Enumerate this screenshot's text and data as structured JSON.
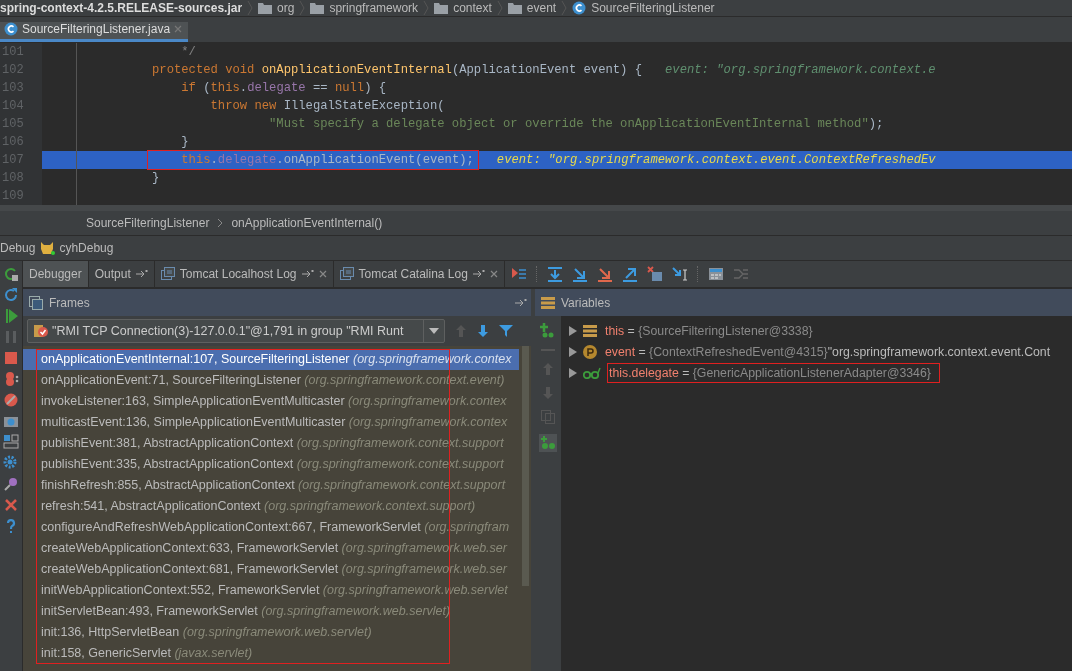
{
  "breadcrumbs": [
    {
      "label": "spring-context-4.2.5.RELEASE-sources.jar",
      "kind": "jar"
    },
    {
      "label": "org",
      "kind": "folder"
    },
    {
      "label": "springframework",
      "kind": "folder"
    },
    {
      "label": "context",
      "kind": "folder"
    },
    {
      "label": "event",
      "kind": "folder"
    },
    {
      "label": "SourceFilteringListener",
      "kind": "class"
    }
  ],
  "editor_tabs": [
    {
      "label": "SourceFilteringListener.java",
      "selected": true
    }
  ],
  "code_lines": [
    {
      "number": "101",
      "highlighted": false,
      "outlined": false,
      "tokens": [
        {
          "kind": "comment",
          "text": "    */"
        }
      ]
    },
    {
      "number": "102",
      "highlighted": false,
      "outlined": false,
      "tokens": [
        {
          "kind": "kw",
          "text": "protected void "
        },
        {
          "kind": "fn",
          "text": "onApplicationEventInternal"
        },
        {
          "kind": "plain",
          "text": "(ApplicationEvent event) {"
        }
      ],
      "hint": "event: \"org.springframework.context.e"
    },
    {
      "number": "103",
      "highlighted": false,
      "outlined": false,
      "tokens": [
        {
          "kind": "kw",
          "text": "    if "
        },
        {
          "kind": "plain",
          "text": "("
        },
        {
          "kind": "kw",
          "text": "this"
        },
        {
          "kind": "plain",
          "text": "."
        },
        {
          "kind": "field",
          "text": "delegate"
        },
        {
          "kind": "plain",
          "text": " == "
        },
        {
          "kind": "kw",
          "text": "null"
        },
        {
          "kind": "plain",
          "text": ") {"
        }
      ]
    },
    {
      "number": "104",
      "highlighted": false,
      "outlined": false,
      "tokens": [
        {
          "kind": "kw",
          "text": "        throw new "
        },
        {
          "kind": "plain",
          "text": "IllegalStateException("
        }
      ]
    },
    {
      "number": "105",
      "highlighted": false,
      "outlined": false,
      "tokens": [
        {
          "kind": "str",
          "text": "                \"Must specify a delegate object or override the onApplicationEventInternal method\""
        },
        {
          "kind": "plain",
          "text": ");"
        }
      ]
    },
    {
      "number": "106",
      "highlighted": false,
      "outlined": false,
      "tokens": [
        {
          "kind": "plain",
          "text": "    }"
        }
      ]
    },
    {
      "number": "107",
      "highlighted": true,
      "outlined": true,
      "tokens": [
        {
          "kind": "kw",
          "text": "    this"
        },
        {
          "kind": "plain",
          "text": "."
        },
        {
          "kind": "field",
          "text": "delegate"
        },
        {
          "kind": "plain",
          "text": ".onApplicationEvent(event);"
        }
      ],
      "hint": "event: \"org.springframework.context.event.ContextRefreshedEv"
    },
    {
      "number": "108",
      "highlighted": false,
      "outlined": false,
      "tokens": [
        {
          "kind": "plain",
          "text": "}"
        }
      ]
    },
    {
      "number": "109",
      "highlighted": false,
      "outlined": false
    }
  ],
  "code_breadcrumbs": [
    "SourceFilteringListener",
    "onApplicationEventInternal()"
  ],
  "debug_title": {
    "label": "Debug",
    "config": "cyhDebug"
  },
  "tool_tabs": [
    {
      "label": "Debugger",
      "selected": true,
      "kind": "plain"
    },
    {
      "label": "Output",
      "selected": false,
      "kind": "pinned"
    },
    {
      "label": "Tomcat Localhost Log",
      "selected": false,
      "kind": "log"
    },
    {
      "label": "Tomcat Catalina Log",
      "selected": false,
      "kind": "log"
    }
  ],
  "frames": {
    "title": "Frames",
    "thread": "\"RMI TCP Connection(3)-127.0.0.1\"@1,791 in group \"RMI Runt",
    "items": [
      {
        "method": "onApplicationEventInternal:107, SourceFilteringListener",
        "package": "(org.springframework.contex",
        "selected": true,
        "outlined": true
      },
      {
        "method": "onApplicationEvent:71, SourceFilteringListener",
        "package": "(org.springframework.context.event)",
        "selected": false,
        "outlined": true
      },
      {
        "method": "invokeListener:163, SimpleApplicationEventMulticaster",
        "package": "(org.springframework.contex",
        "selected": false,
        "outlined": true
      },
      {
        "method": "multicastEvent:136, SimpleApplicationEventMulticaster",
        "package": "(org.springframework.contex",
        "selected": false,
        "outlined": true
      },
      {
        "method": "publishEvent:381, AbstractApplicationContext",
        "package": "(org.springframework.context.support",
        "selected": false,
        "outlined": true
      },
      {
        "method": "publishEvent:335, AbstractApplicationContext",
        "package": "(org.springframework.context.support",
        "selected": false,
        "outlined": true
      },
      {
        "method": "finishRefresh:855, AbstractApplicationContext",
        "package": "(org.springframework.context.support",
        "selected": false,
        "outlined": true
      },
      {
        "method": "refresh:541, AbstractApplicationContext",
        "package": "(org.springframework.context.support)",
        "selected": false,
        "outlined": true
      },
      {
        "method": "configureAndRefreshWebApplicationContext:667, FrameworkServlet",
        "package": "(org.springfram",
        "selected": false,
        "outlined": true
      },
      {
        "method": "createWebApplicationContext:633, FrameworkServlet",
        "package": "(org.springframework.web.ser",
        "selected": false,
        "outlined": true
      },
      {
        "method": "createWebApplicationContext:681, FrameworkServlet",
        "package": "(org.springframework.web.ser",
        "selected": false,
        "outlined": true
      },
      {
        "method": "initWebApplicationContext:552, FrameworkServlet",
        "package": "(org.springframework.web.servlet",
        "selected": false,
        "outlined": true
      },
      {
        "method": "initServletBean:493, FrameworkServlet",
        "package": "(org.springframework.web.servlet)",
        "selected": false,
        "outlined": true
      },
      {
        "method": "init:136, HttpServletBean",
        "package": "(org.springframework.web.servlet)",
        "selected": false,
        "outlined": true
      },
      {
        "method": "init:158, GenericServlet",
        "package": "(javax.servlet)",
        "selected": false,
        "outlined": true
      }
    ]
  },
  "variables": {
    "title": "Variables",
    "items": [
      {
        "kind": "field",
        "name": "this",
        "separator": "=",
        "value": "{SourceFilteringListener@3338}",
        "outlined": false
      },
      {
        "kind": "param",
        "name": "event",
        "separator": "=",
        "value": "{ContextRefreshedEvent@4315}",
        "extra": "\"org.springframework.context.event.Cont",
        "outlined": false
      },
      {
        "kind": "watch",
        "name": "this.delegate",
        "separator": "=",
        "value": "{GenericApplicationListenerAdapter@3346}",
        "outlined": true
      }
    ]
  }
}
